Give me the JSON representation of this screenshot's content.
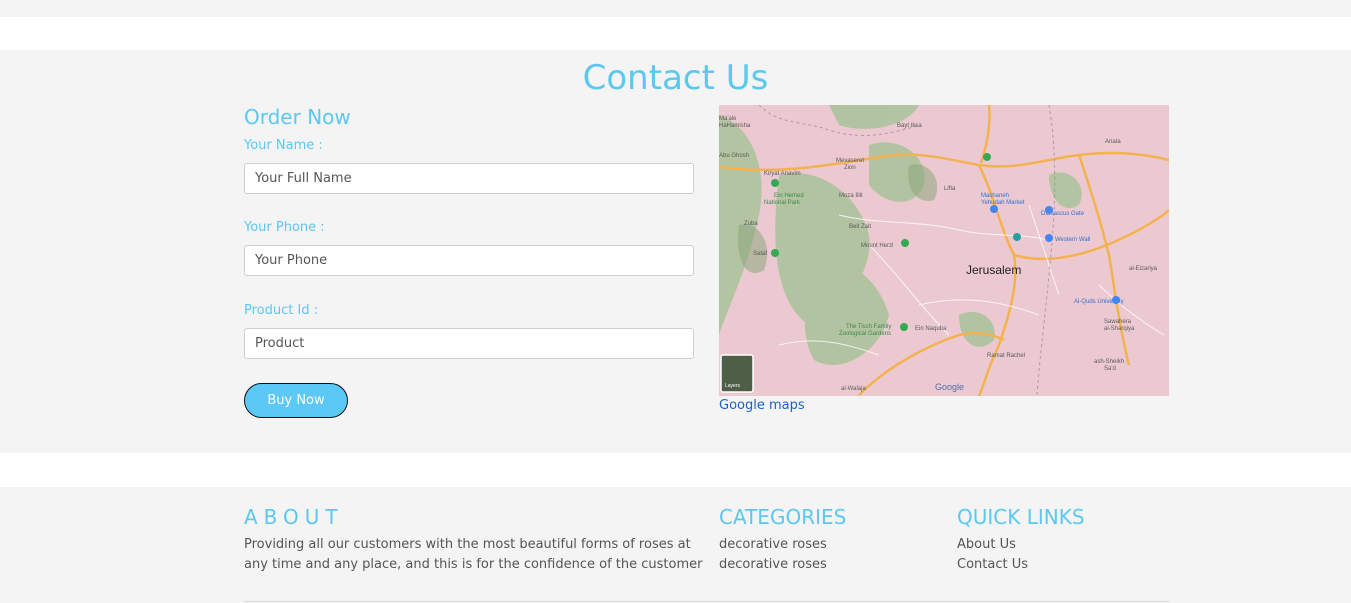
{
  "contact": {
    "title": "Contact Us",
    "order_title": "Order Now",
    "name_label": "Your Name :",
    "name_placeholder": "Your Full Name",
    "phone_label": "Your Phone :",
    "phone_placeholder": "Your Phone",
    "product_label": "Product Id :",
    "product_placeholder": "Product",
    "buy_label": "Buy Now"
  },
  "map": {
    "link_label": "Google maps",
    "city_label": "Jerusalem",
    "google_logo": "Google",
    "layers_label": "Layers",
    "places": [
      "Bayt Iksa",
      "Kiryat Anavim",
      "Mevaseret Zion",
      "Moza Illit",
      "Beit Zait",
      "Mount Herzl",
      "Lifta",
      "Machaneh Yehudah Market",
      "Damascus Gate",
      "Western Wall",
      "Anata",
      "al-Eizariya",
      "Al-Quds University",
      "Sawahera al-Sharqiya",
      "Ramat Rachel",
      "ash-Sheikh Sa'd",
      "Zuba",
      "Sataf",
      "Ein Hemed National Park",
      "The Tisch Family Zoological Gardens",
      "al-Walaja",
      "Ein Naquba",
      "Ma'ale HaHamisha",
      "Abu Ghosh"
    ],
    "colors": {
      "land": "#ecc9d0",
      "green": "#a9c39a",
      "road": "#f3b24f"
    }
  },
  "footer": {
    "about_heading": "ABOUT",
    "about_text": "Providing all our customers with the most beautiful forms of roses at any time and any place, and this is for the confidence of the customer",
    "categories_heading": "CATEGORIES",
    "categories": [
      "decorative roses",
      "decorative roses"
    ],
    "quicklinks_heading": "QUICK LINKS",
    "quicklinks": [
      "About Us",
      "Contact Us"
    ]
  },
  "colors": {
    "accent": "#5bc8ef",
    "button": "#5bc8f5",
    "section_bg": "#f4f4f4",
    "link": "#1a63c6"
  }
}
